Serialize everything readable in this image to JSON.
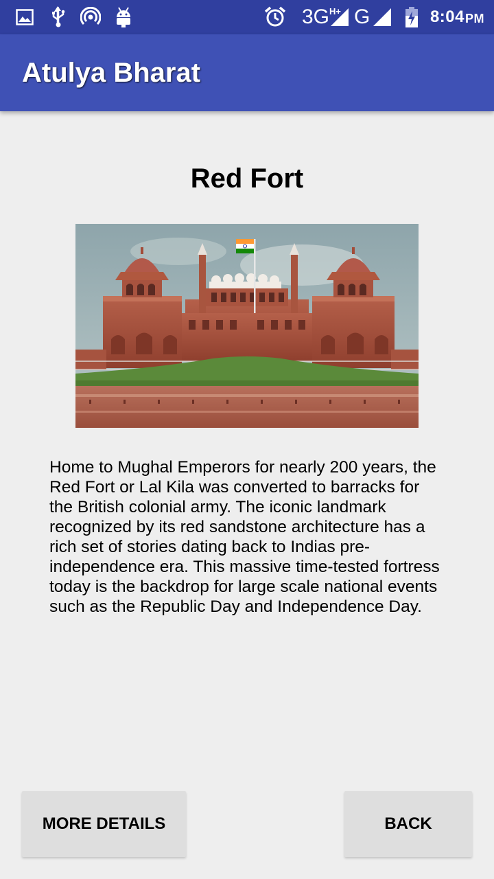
{
  "status_bar": {
    "icons": [
      "image-icon",
      "usb-icon",
      "hotspot-icon",
      "android-debug-icon",
      "alarm-icon",
      "signal-icon",
      "signal-icon",
      "battery-charging-icon"
    ],
    "network_1": "3G",
    "network_1_super": "H+",
    "network_2": "G",
    "time": "8:04",
    "time_suffix": "PM",
    "bg_color": "#303f9f"
  },
  "app_bar": {
    "title": "Atulya Bharat",
    "bg_color": "#3f51b5"
  },
  "content": {
    "title": "Red Fort",
    "description": "Home to Mughal Emperors for nearly 200 years, the Red Fort or Lal Kila was converted to barracks for the British colonial army. The iconic landmark recognized by its red sandstone architecture has a rich set of stories dating back to Indias pre-independence era. This massive time-tested fortress today is the backdrop for large scale national events such as the Republic Day and Independence Day."
  },
  "buttons": {
    "more_details": "MORE DETAILS",
    "back": "BACK"
  }
}
